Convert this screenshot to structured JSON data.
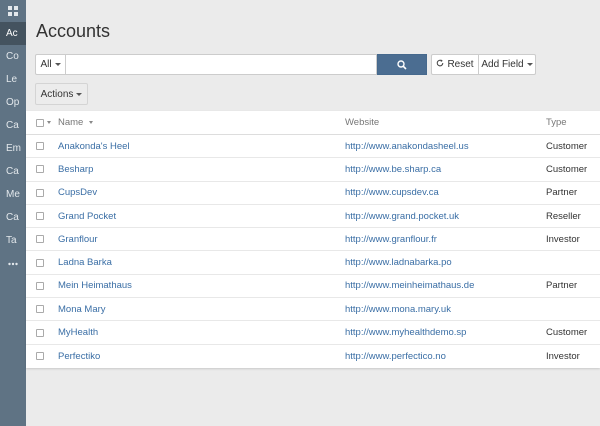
{
  "sidebar": {
    "items": [
      {
        "label": "Ac",
        "active": true
      },
      {
        "label": "Co",
        "active": false
      },
      {
        "label": "Le",
        "active": false
      },
      {
        "label": "Op",
        "active": false
      },
      {
        "label": "Ca",
        "active": false
      },
      {
        "label": "Em",
        "active": false
      },
      {
        "label": "Ca",
        "active": false
      },
      {
        "label": "Me",
        "active": false
      },
      {
        "label": "Ca",
        "active": false
      },
      {
        "label": "Ta",
        "active": false
      }
    ]
  },
  "header": {
    "title": "Accounts"
  },
  "search": {
    "scope_label": "All",
    "value": "",
    "reset_label": "Reset",
    "add_field_label": "Add Field"
  },
  "actions": {
    "label": "Actions"
  },
  "table": {
    "columns": {
      "name": "Name",
      "website": "Website",
      "type": "Type"
    },
    "rows": [
      {
        "name": "Anakonda's Heel",
        "website": "http://www.anakondasheel.us",
        "type": "Customer"
      },
      {
        "name": "Besharp",
        "website": "http://www.be.sharp.ca",
        "type": "Customer"
      },
      {
        "name": "CupsDev",
        "website": "http://www.cupsdev.ca",
        "type": "Partner"
      },
      {
        "name": "Grand Pocket",
        "website": "http://www.grand.pocket.uk",
        "type": "Reseller"
      },
      {
        "name": "Granflour",
        "website": "http://www.granflour.fr",
        "type": "Investor"
      },
      {
        "name": "Ladna Barka",
        "website": "http://www.ladnabarka.po",
        "type": ""
      },
      {
        "name": "Mein Heimathaus",
        "website": "http://www.meinheimathaus.de",
        "type": "Partner"
      },
      {
        "name": "Mona Mary",
        "website": "http://www.mona.mary.uk",
        "type": ""
      },
      {
        "name": "MyHealth",
        "website": "http://www.myhealthdemo.sp",
        "type": "Customer"
      },
      {
        "name": "Perfectiko",
        "website": "http://www.perfectico.no",
        "type": "Investor"
      }
    ]
  },
  "colors": {
    "sidebar": "#5f7384",
    "sidebar_active": "#44535f",
    "primary": "#4b6d91",
    "link": "#3a6ea5"
  }
}
